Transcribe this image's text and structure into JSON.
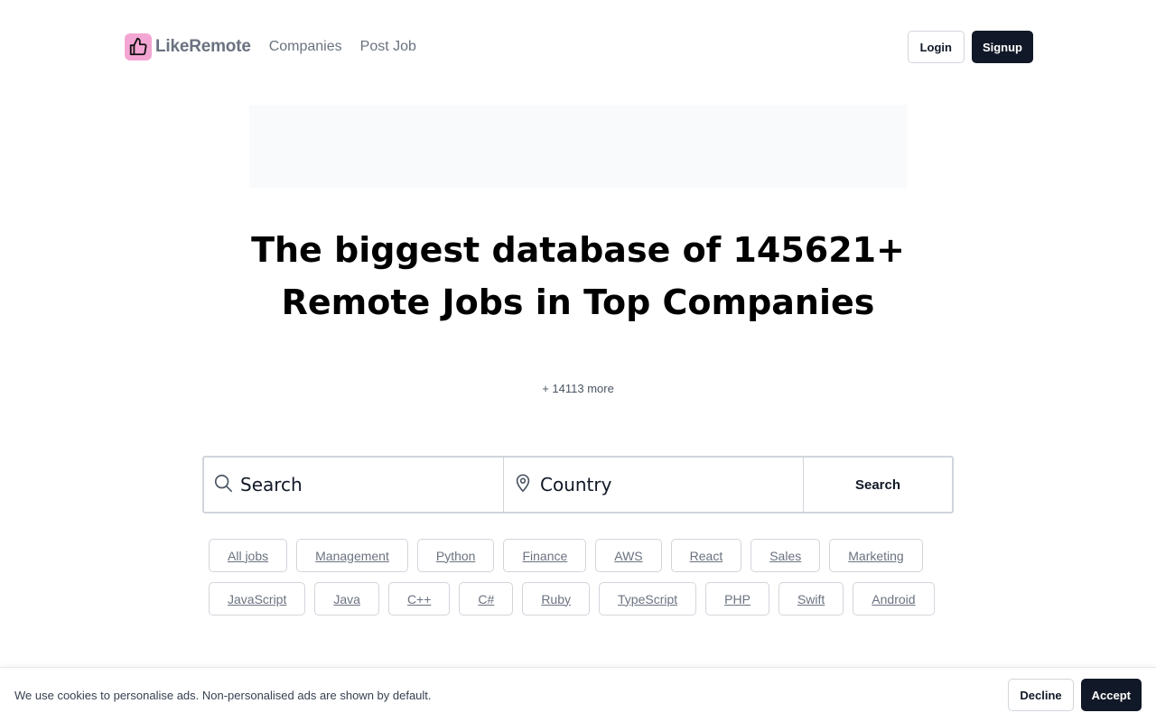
{
  "header": {
    "brand": "LikeRemote",
    "logo_icon": "thumbs-up-icon",
    "nav": [
      "Companies",
      "Post Job"
    ],
    "login_label": "Login",
    "signup_label": "Signup"
  },
  "hero": {
    "headline": "The biggest database of 145621+ Remote Jobs in Top Companies",
    "more_text": "+ 14113 more"
  },
  "search": {
    "keyword_placeholder": "Search",
    "country_placeholder": "Country",
    "button_label": "Search",
    "keyword_icon": "search-icon",
    "country_icon": "map-pin-icon"
  },
  "tags": {
    "row1": [
      "All jobs",
      "Management",
      "Python",
      "Finance",
      "AWS",
      "React",
      "Sales",
      "Marketing"
    ],
    "row2": [
      "JavaScript",
      "Java",
      "C++",
      "C#",
      "Ruby",
      "TypeScript",
      "PHP",
      "Swift",
      "Android"
    ]
  },
  "cookie": {
    "text": "We use cookies to personalise ads. Non-personalised ads are shown by default.",
    "decline_label": "Decline",
    "accept_label": "Accept"
  },
  "colors": {
    "logo_bg": "#f3a6d3",
    "dark_button": "#111827",
    "muted_text": "#6b7280",
    "border": "#d1d5db"
  }
}
